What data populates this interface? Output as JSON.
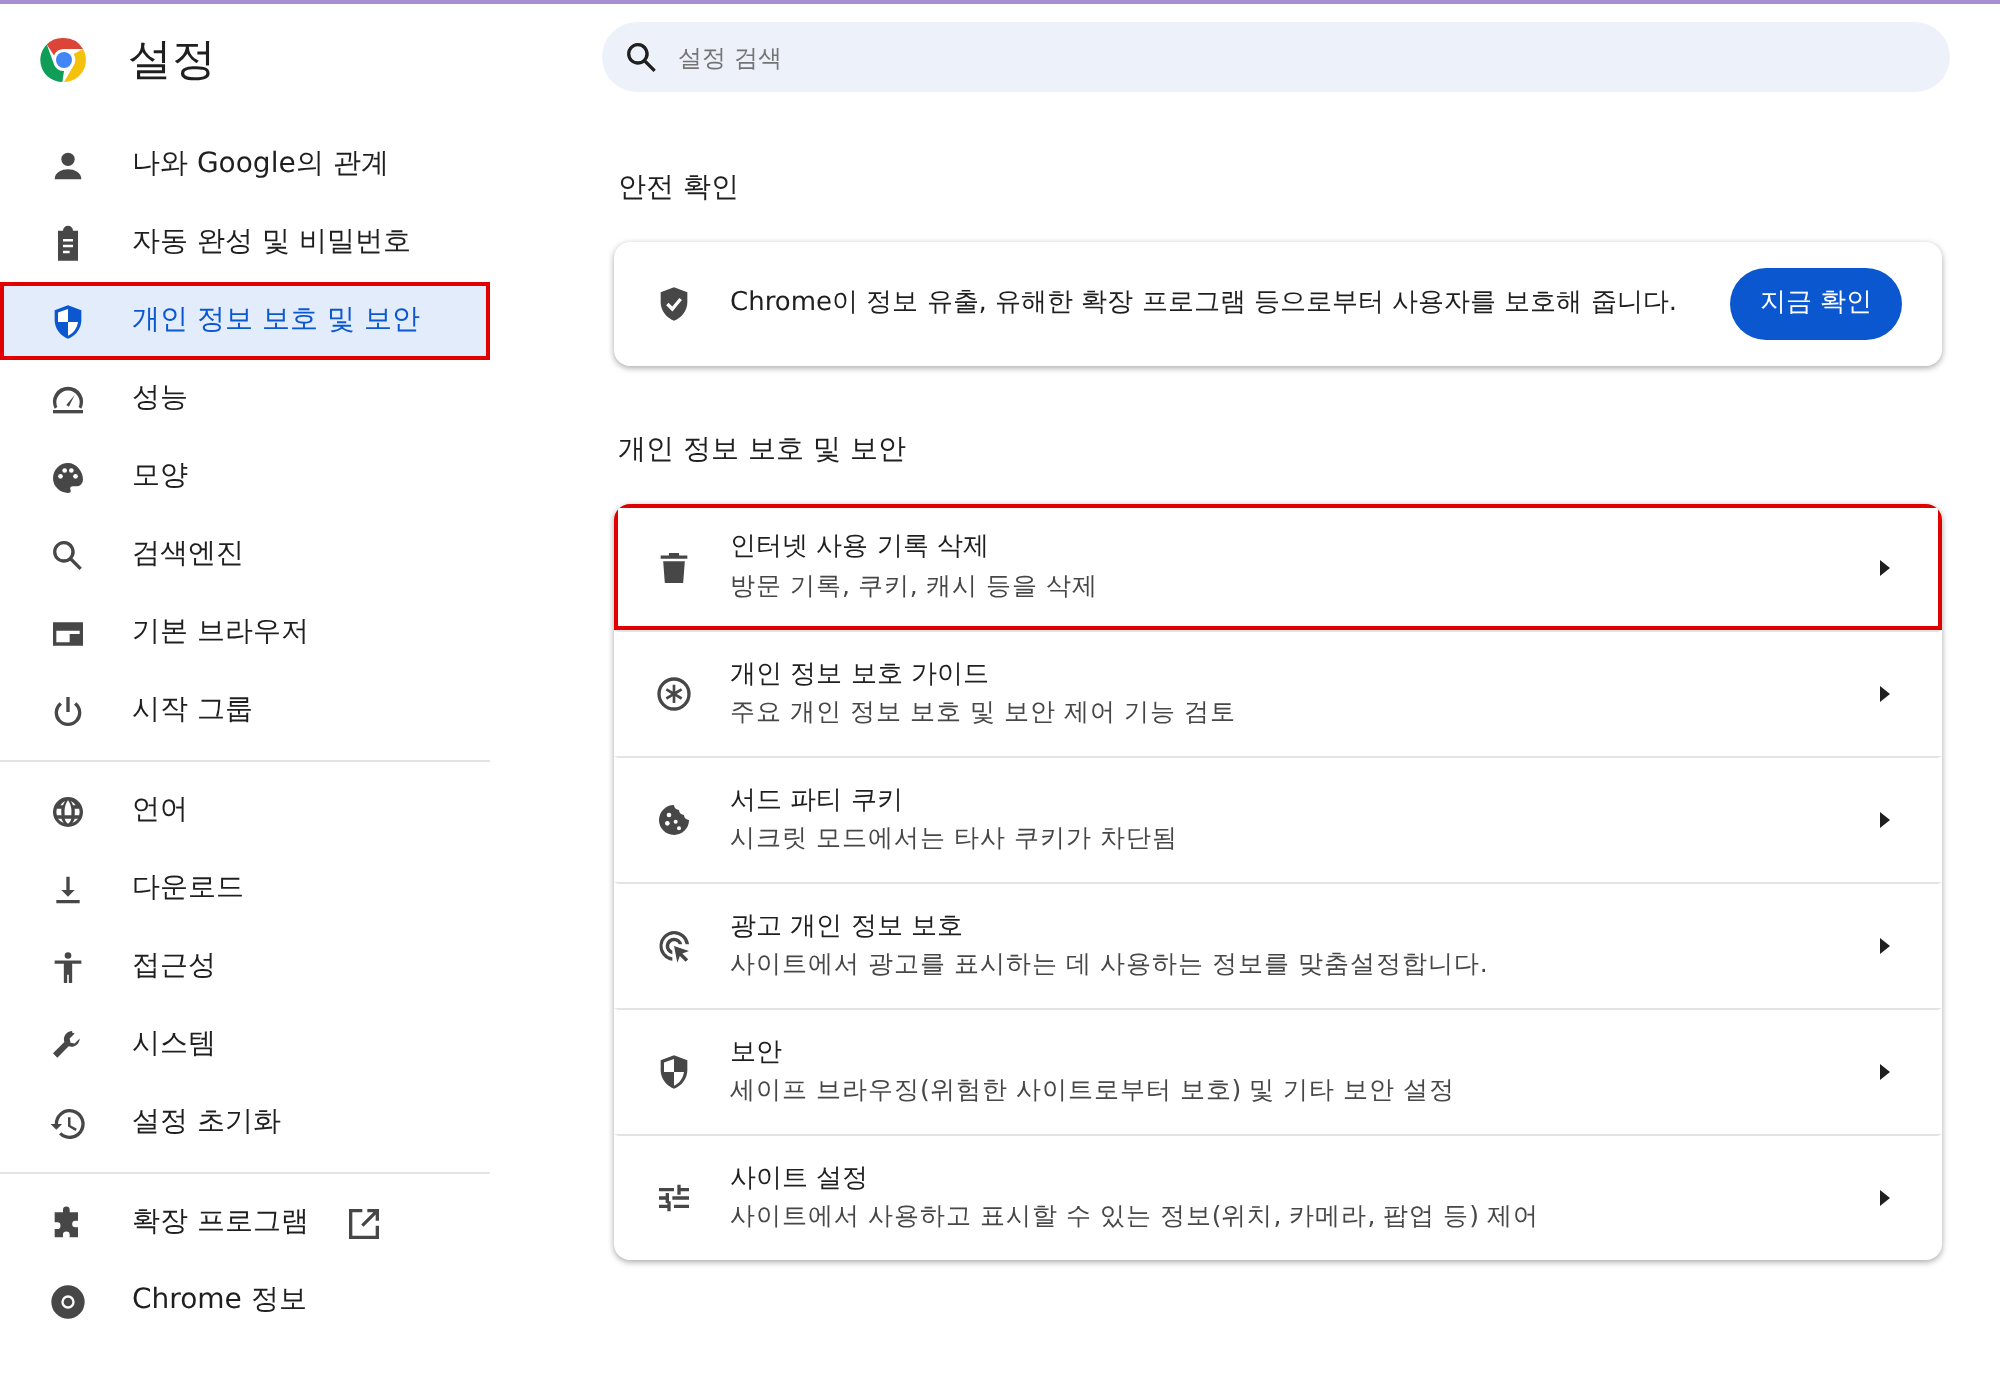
{
  "header": {
    "title": "설정"
  },
  "search": {
    "placeholder": "설정 검색"
  },
  "sidebar": {
    "groups": [
      [
        {
          "label": "나와 Google의 관계",
          "selected": false,
          "highlighted": false
        },
        {
          "label": "자동 완성 및 비밀번호",
          "selected": false,
          "highlighted": false
        },
        {
          "label": "개인 정보 보호 및 보안",
          "selected": true,
          "highlighted": true
        },
        {
          "label": "성능",
          "selected": false,
          "highlighted": false
        },
        {
          "label": "모양",
          "selected": false,
          "highlighted": false
        },
        {
          "label": "검색엔진",
          "selected": false,
          "highlighted": false
        },
        {
          "label": "기본 브라우저",
          "selected": false,
          "highlighted": false
        },
        {
          "label": "시작 그룹",
          "selected": false,
          "highlighted": false
        }
      ],
      [
        {
          "label": "언어",
          "selected": false,
          "highlighted": false
        },
        {
          "label": "다운로드",
          "selected": false,
          "highlighted": false
        },
        {
          "label": "접근성",
          "selected": false,
          "highlighted": false
        },
        {
          "label": "시스템",
          "selected": false,
          "highlighted": false
        },
        {
          "label": "설정 초기화",
          "selected": false,
          "highlighted": false
        }
      ],
      [
        {
          "label": "확장 프로그램",
          "selected": false,
          "highlighted": false,
          "external": true
        },
        {
          "label": "Chrome 정보",
          "selected": false,
          "highlighted": false
        }
      ]
    ]
  },
  "safety_check": {
    "heading": "안전 확인",
    "text": "Chrome이 정보 유출, 유해한 확장 프로그램 등으로부터 사용자를 보호해 줍니다.",
    "button": "지금 확인"
  },
  "privacy": {
    "heading": "개인 정보 보호 및 보안",
    "rows": [
      {
        "title": "인터넷 사용 기록 삭제",
        "subtitle": "방문 기록, 쿠키, 캐시 등을 삭제",
        "highlighted": true
      },
      {
        "title": "개인 정보 보호 가이드",
        "subtitle": "주요 개인 정보 보호 및 보안 제어 기능 검토",
        "highlighted": false
      },
      {
        "title": "서드 파티 쿠키",
        "subtitle": "시크릿 모드에서는 타사 쿠키가 차단됨",
        "highlighted": false
      },
      {
        "title": "광고 개인 정보 보호",
        "subtitle": "사이트에서 광고를 표시하는 데 사용하는 정보를 맞춤설정합니다.",
        "highlighted": false
      },
      {
        "title": "보안",
        "subtitle": "세이프 브라우징(위험한 사이트로부터 보호) 및 기타 보안 설정",
        "highlighted": false
      },
      {
        "title": "사이트 설정",
        "subtitle": "사이트에서 사용하고 표시할 수 있는 정보(위치, 카메라, 팝업 등) 제어",
        "highlighted": false
      }
    ]
  }
}
